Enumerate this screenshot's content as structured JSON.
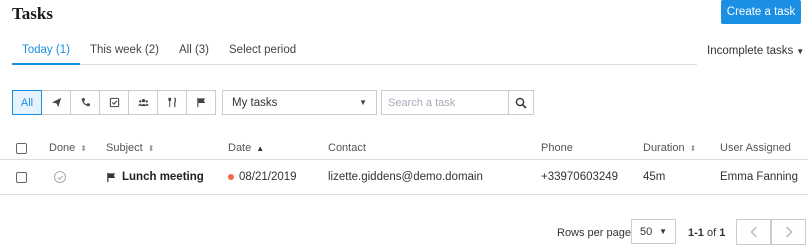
{
  "page": {
    "title": "Tasks",
    "create_button": "Create a task"
  },
  "tabs": [
    {
      "label": "Today (1)",
      "active": true
    },
    {
      "label": "This week (2)",
      "active": false
    },
    {
      "label": "All (3)",
      "active": false
    },
    {
      "label": "Select period",
      "active": false
    }
  ],
  "status_filter": {
    "label": "Incomplete tasks"
  },
  "type_filters": {
    "all_label": "All",
    "icons": [
      "send-icon",
      "phone-icon",
      "checkbox-icon",
      "people-icon",
      "fork-knife-icon",
      "flag-icon"
    ]
  },
  "owner_filter": {
    "value": "My tasks"
  },
  "search": {
    "placeholder": "Search a task"
  },
  "table": {
    "columns": {
      "done": "Done",
      "subject": "Subject",
      "date": "Date",
      "contact": "Contact",
      "phone": "Phone",
      "duration": "Duration",
      "user": "User Assigned"
    },
    "rows": [
      {
        "type_icon": "flag-icon",
        "subject": "Lunch meeting",
        "date": "08/21/2019",
        "contact": "lizette.giddens@demo.domain",
        "phone": "+33970603249",
        "duration": "45m",
        "user": "Emma Fanning"
      }
    ]
  },
  "pagination": {
    "rows_per_page_label": "Rows per page",
    "rows_per_page": "50",
    "range": "1-1",
    "of_label": "of",
    "total": "1"
  },
  "colors": {
    "accent": "#1a8fe3",
    "overdue_dot": "#f06a4a"
  }
}
